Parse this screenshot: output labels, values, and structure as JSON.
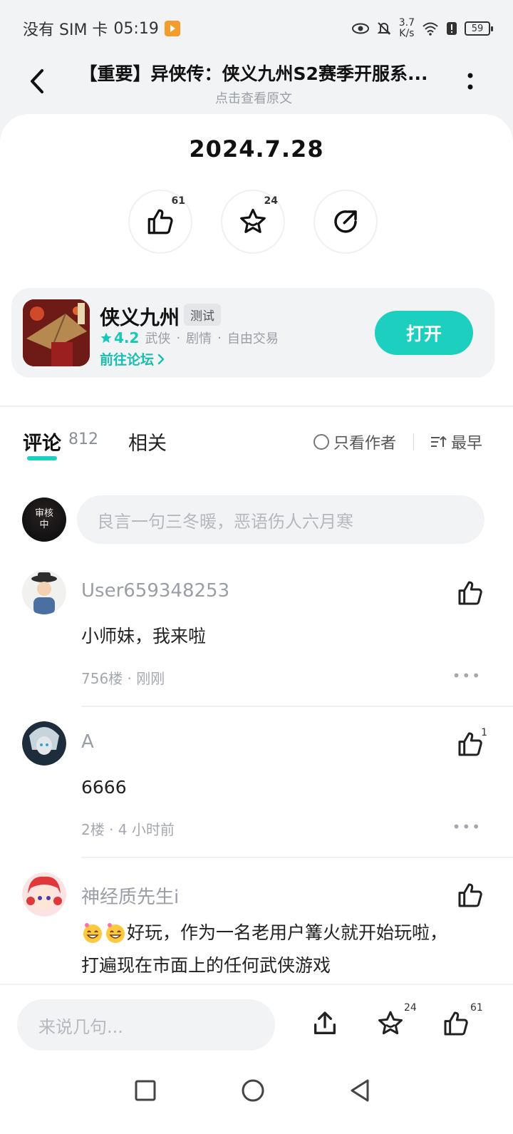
{
  "status_bar": {
    "carrier": "没有 SIM 卡",
    "time": "05:19",
    "net_speed_value": "3.7",
    "net_speed_unit": "K/s",
    "battery": "59"
  },
  "header": {
    "title": "【重要】异侠传：侠义九州S2赛季开服系...",
    "subtitle": "点击查看原文"
  },
  "post": {
    "date": "2024.7.28",
    "like_count": "61",
    "favorite_count": "24"
  },
  "game": {
    "name": "侠义九州",
    "tag": "测试",
    "rating": "4.2",
    "genres": [
      "武侠",
      "剧情",
      "自由交易"
    ],
    "forum_link": "前往论坛",
    "open_label": "打开"
  },
  "tabs": {
    "comments_label": "评论",
    "comments_count": "812",
    "related_label": "相关",
    "author_only_label": "只看作者",
    "sort_label": "最早"
  },
  "composer": {
    "avatar_text_1": "审核",
    "avatar_text_2": "中",
    "placeholder": "良言一句三冬暖，恶语伤人六月寒"
  },
  "comments": [
    {
      "name": "User659348253",
      "text": "小师妹，我来啦",
      "meta": "756楼 · 刚刚",
      "likes": ""
    },
    {
      "name": "A",
      "text": "6666",
      "meta": "2楼 · 4 小时前",
      "likes": "1"
    },
    {
      "name": "神经质先生i",
      "text_line1": "好玩，作为一名老用户篝火就开始玩啦，",
      "text_line2": "打遍现在市面上的任何武侠游戏",
      "likes": ""
    }
  ],
  "bottom_bar": {
    "placeholder": "来说几句...",
    "favorite_count": "24",
    "like_count": "61"
  },
  "colors": {
    "accent": "#1ccfbf",
    "background": "#f2f3f5"
  }
}
